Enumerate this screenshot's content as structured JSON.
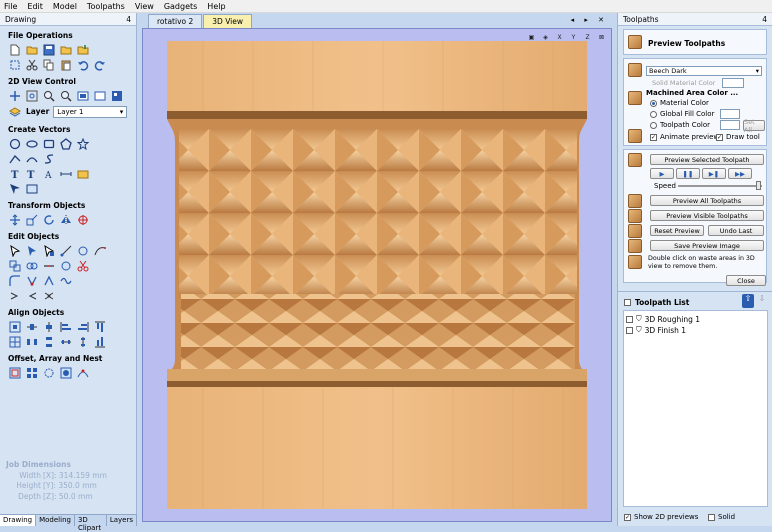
{
  "menu": [
    "File",
    "Edit",
    "Model",
    "Toolpaths",
    "View",
    "Gadgets",
    "Help"
  ],
  "left": {
    "title": "Drawing",
    "pin": "4",
    "sections": {
      "file_ops": "File Operations",
      "view_control": "2D View Control",
      "layer_label": "Layer",
      "layer_value": "Layer 1",
      "create_vectors": "Create Vectors",
      "transform": "Transform Objects",
      "edit": "Edit Objects",
      "align": "Align Objects",
      "offset": "Offset, Array and Nest"
    },
    "job": {
      "title": "Job Dimensions",
      "width_label": "Width",
      "width_value": "[X]: 314.159 mm",
      "height_label": "Height",
      "height_value": "[Y]: 350.0 mm",
      "depth_label": "Depth",
      "depth_value": "[Z]: 50.0 mm"
    },
    "tabs": [
      "Drawing",
      "Modeling",
      "3D Clipart",
      "Layers"
    ]
  },
  "center": {
    "tabs": [
      "rotativo 2",
      "3D View"
    ],
    "active_tab": "3D View",
    "tab_controls": "◂ ▸ ✕",
    "view_icons": [
      "zoom-fit",
      "iso",
      "X",
      "Y",
      "Z",
      "close"
    ]
  },
  "right": {
    "title": "Toolpaths",
    "pin": "4",
    "preview_title": "Preview Toolpaths",
    "material_value": "Beech Dark",
    "solid_material_color": "Solid Material Color",
    "machined_area": "Machined Area Color ...",
    "material_color": "Material Color",
    "global_fill": "Global Fill Color",
    "toolpath_color": "Toolpath Color",
    "set_all": "Set All",
    "animate_preview": "Animate preview",
    "draw_tool": "Draw tool",
    "preview_selected": "Preview Selected Toolpath",
    "speed": "Speed",
    "preview_all": "Preview All Toolpaths",
    "preview_visible": "Preview Visible Toolpaths",
    "reset_preview": "Reset Preview",
    "undo_last": "Undo Last",
    "save_preview": "Save Preview Image",
    "hint": "Double click on waste areas in 3D view to remove them.",
    "close": "Close",
    "toolpath_list_title": "Toolpath List",
    "toolpaths": [
      "3D Roughing 1",
      "3D Finish 1"
    ],
    "show_2d": "Show 2D previews",
    "solid": "Solid"
  }
}
